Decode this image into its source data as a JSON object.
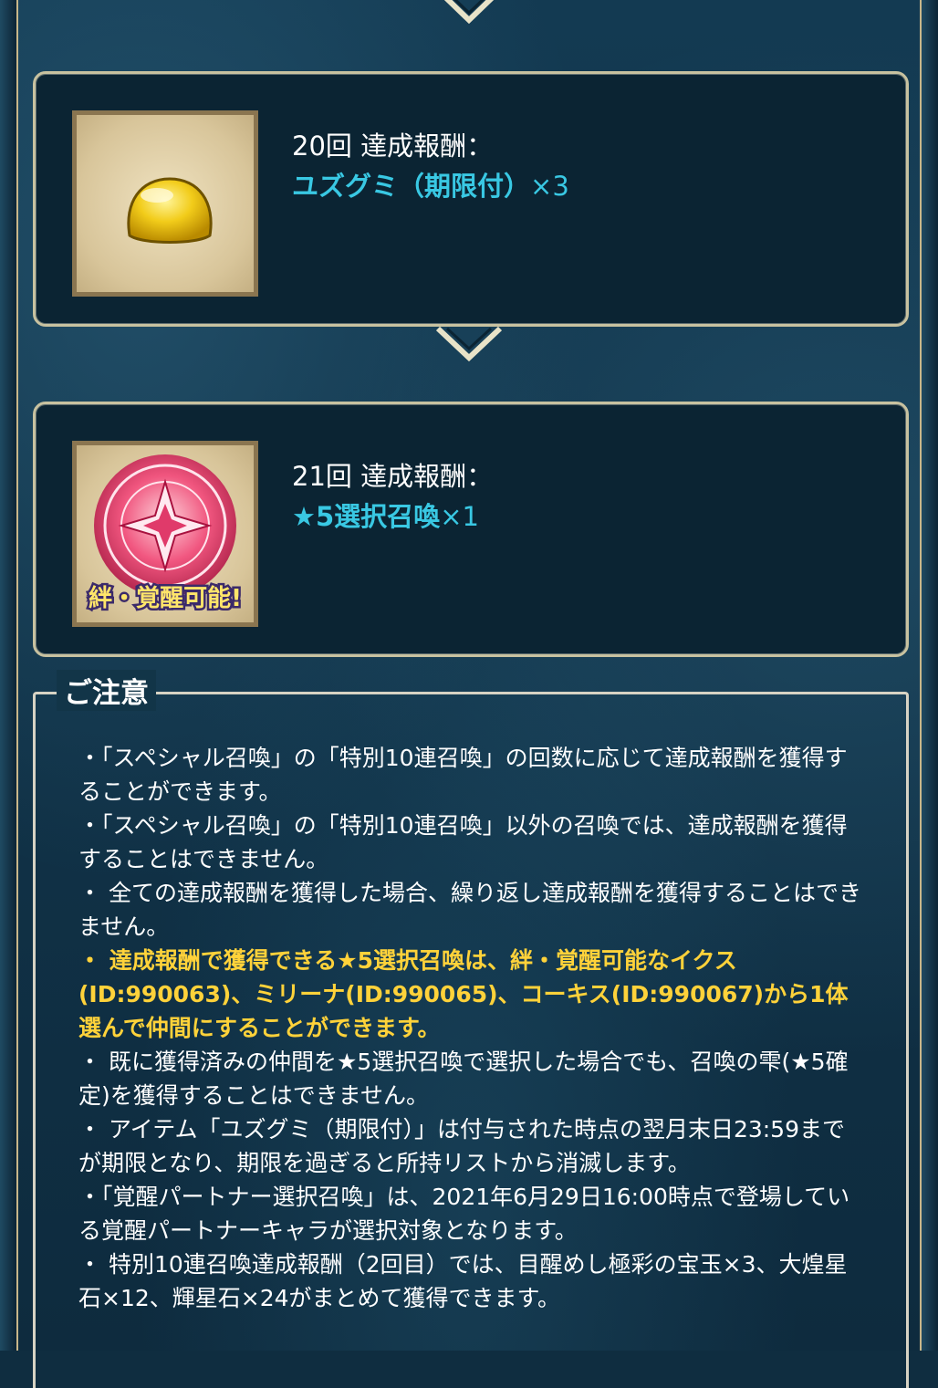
{
  "rewards": [
    {
      "title": "20回 達成報酬：",
      "item": "ユズグミ（期限付）",
      "count": "×3",
      "icon": "yellow-gummy-icon"
    },
    {
      "title": "21回 達成報酬：",
      "item": "★5選択召喚",
      "count": "×1",
      "icon": "summon-circle-icon",
      "badge": "絆・覚醒可能!"
    }
  ],
  "notes": {
    "heading": "ご注意",
    "items": [
      "・「スペシャル召喚」の「特別10連召喚」の回数に応じて達成報酬を獲得することができます。",
      "・「スペシャル召喚」の「特別10連召喚」以外の召喚では、達成報酬を獲得することはできません。",
      "・ 全ての達成報酬を獲得した場合、繰り返し達成報酬を獲得することはできません。",
      "・ 達成報酬で獲得できる★5選択召喚は、絆・覚醒可能なイクス(ID:990063)、ミリーナ(ID:990065)、コーキス(ID:990067)から1体選んで仲間にすることができます。",
      "・ 既に獲得済みの仲間を★5選択召喚で選択した場合でも、召喚の雫(★5確定)を獲得することはできません。",
      "・ アイテム「ユズグミ（期限付）」は付与された時点の翌月末日23:59までが期限となり、期限を過ぎると所持リストから消滅します。",
      "・「覚醒パートナー選択召喚」は、2021年6月29日16:00時点で登場している覚醒パートナーキャラが選択対象となります。",
      "・ 特別10連召喚達成報酬（2回目）では、目醒めし極彩の宝玉×3、大煌星石×12、輝星石×24がまとめて獲得できます。"
    ]
  },
  "colors": {
    "accent": "#39c8e3",
    "highlight": "#ffd23a",
    "frame": "#c8c2a0"
  }
}
